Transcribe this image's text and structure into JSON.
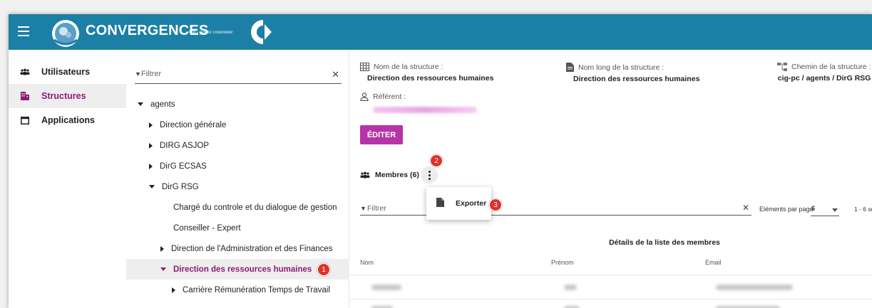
{
  "header": {
    "app_title": "CONVERGENCES",
    "org_name": "CIG petite couronne",
    "brand_color": "#1c7fa5"
  },
  "sidebar": {
    "items": [
      {
        "label": "Utilisateurs",
        "icon": "users-icon",
        "active": false
      },
      {
        "label": "Structures",
        "icon": "building-icon",
        "active": true
      },
      {
        "label": "Applications",
        "icon": "window-icon",
        "active": false
      }
    ],
    "active_color": "#8e1b77"
  },
  "tree": {
    "filter_placeholder": "Filtrer",
    "nodes": [
      {
        "label": "agents",
        "caret": "down"
      },
      {
        "label": "Direction générale",
        "caret": "right"
      },
      {
        "label": "DIRG ASJOP",
        "caret": "right"
      },
      {
        "label": "DirG ECSAS",
        "caret": "right"
      },
      {
        "label": "DirG RSG",
        "caret": "down"
      },
      {
        "label": "Chargé du controle et du dialogue de gestion",
        "caret": "none"
      },
      {
        "label": "Conseiller - Expert",
        "caret": "none"
      },
      {
        "label": "Direction de l'Administration et des Finances",
        "caret": "right"
      },
      {
        "label": "Direction des ressources humaines",
        "caret": "down",
        "selected": true
      },
      {
        "label": "Carrière Rémunération Temps de Travail",
        "caret": "right"
      }
    ]
  },
  "details": {
    "name_label": "Nom de la structure :",
    "name_value": "Direction des ressources humaines",
    "long_name_label": "Nom long de la structure :",
    "long_name_value": "Direction des ressources humaines",
    "path_label": "Chemin de la structure :",
    "path_value": "cig-pc / agents / DirG RSG",
    "referent_label": "Référent :"
  },
  "actions": {
    "edit_label": "ÉDITER",
    "edit_color": "#b534a7"
  },
  "members": {
    "title": "Membres (6)",
    "menu_items": [
      {
        "label": "Exporter",
        "icon": "document-icon"
      }
    ],
    "filter_placeholder": "Filtrer",
    "per_page_label": "Eléments par page",
    "per_page_value": "6",
    "pager_text": "1 - 6 su",
    "table_title": "Détails de la liste des membres",
    "columns": [
      "Nom",
      "Prénom",
      "Email"
    ]
  },
  "badges": [
    "1",
    "2",
    "3"
  ],
  "badge_color": "#e0312b"
}
